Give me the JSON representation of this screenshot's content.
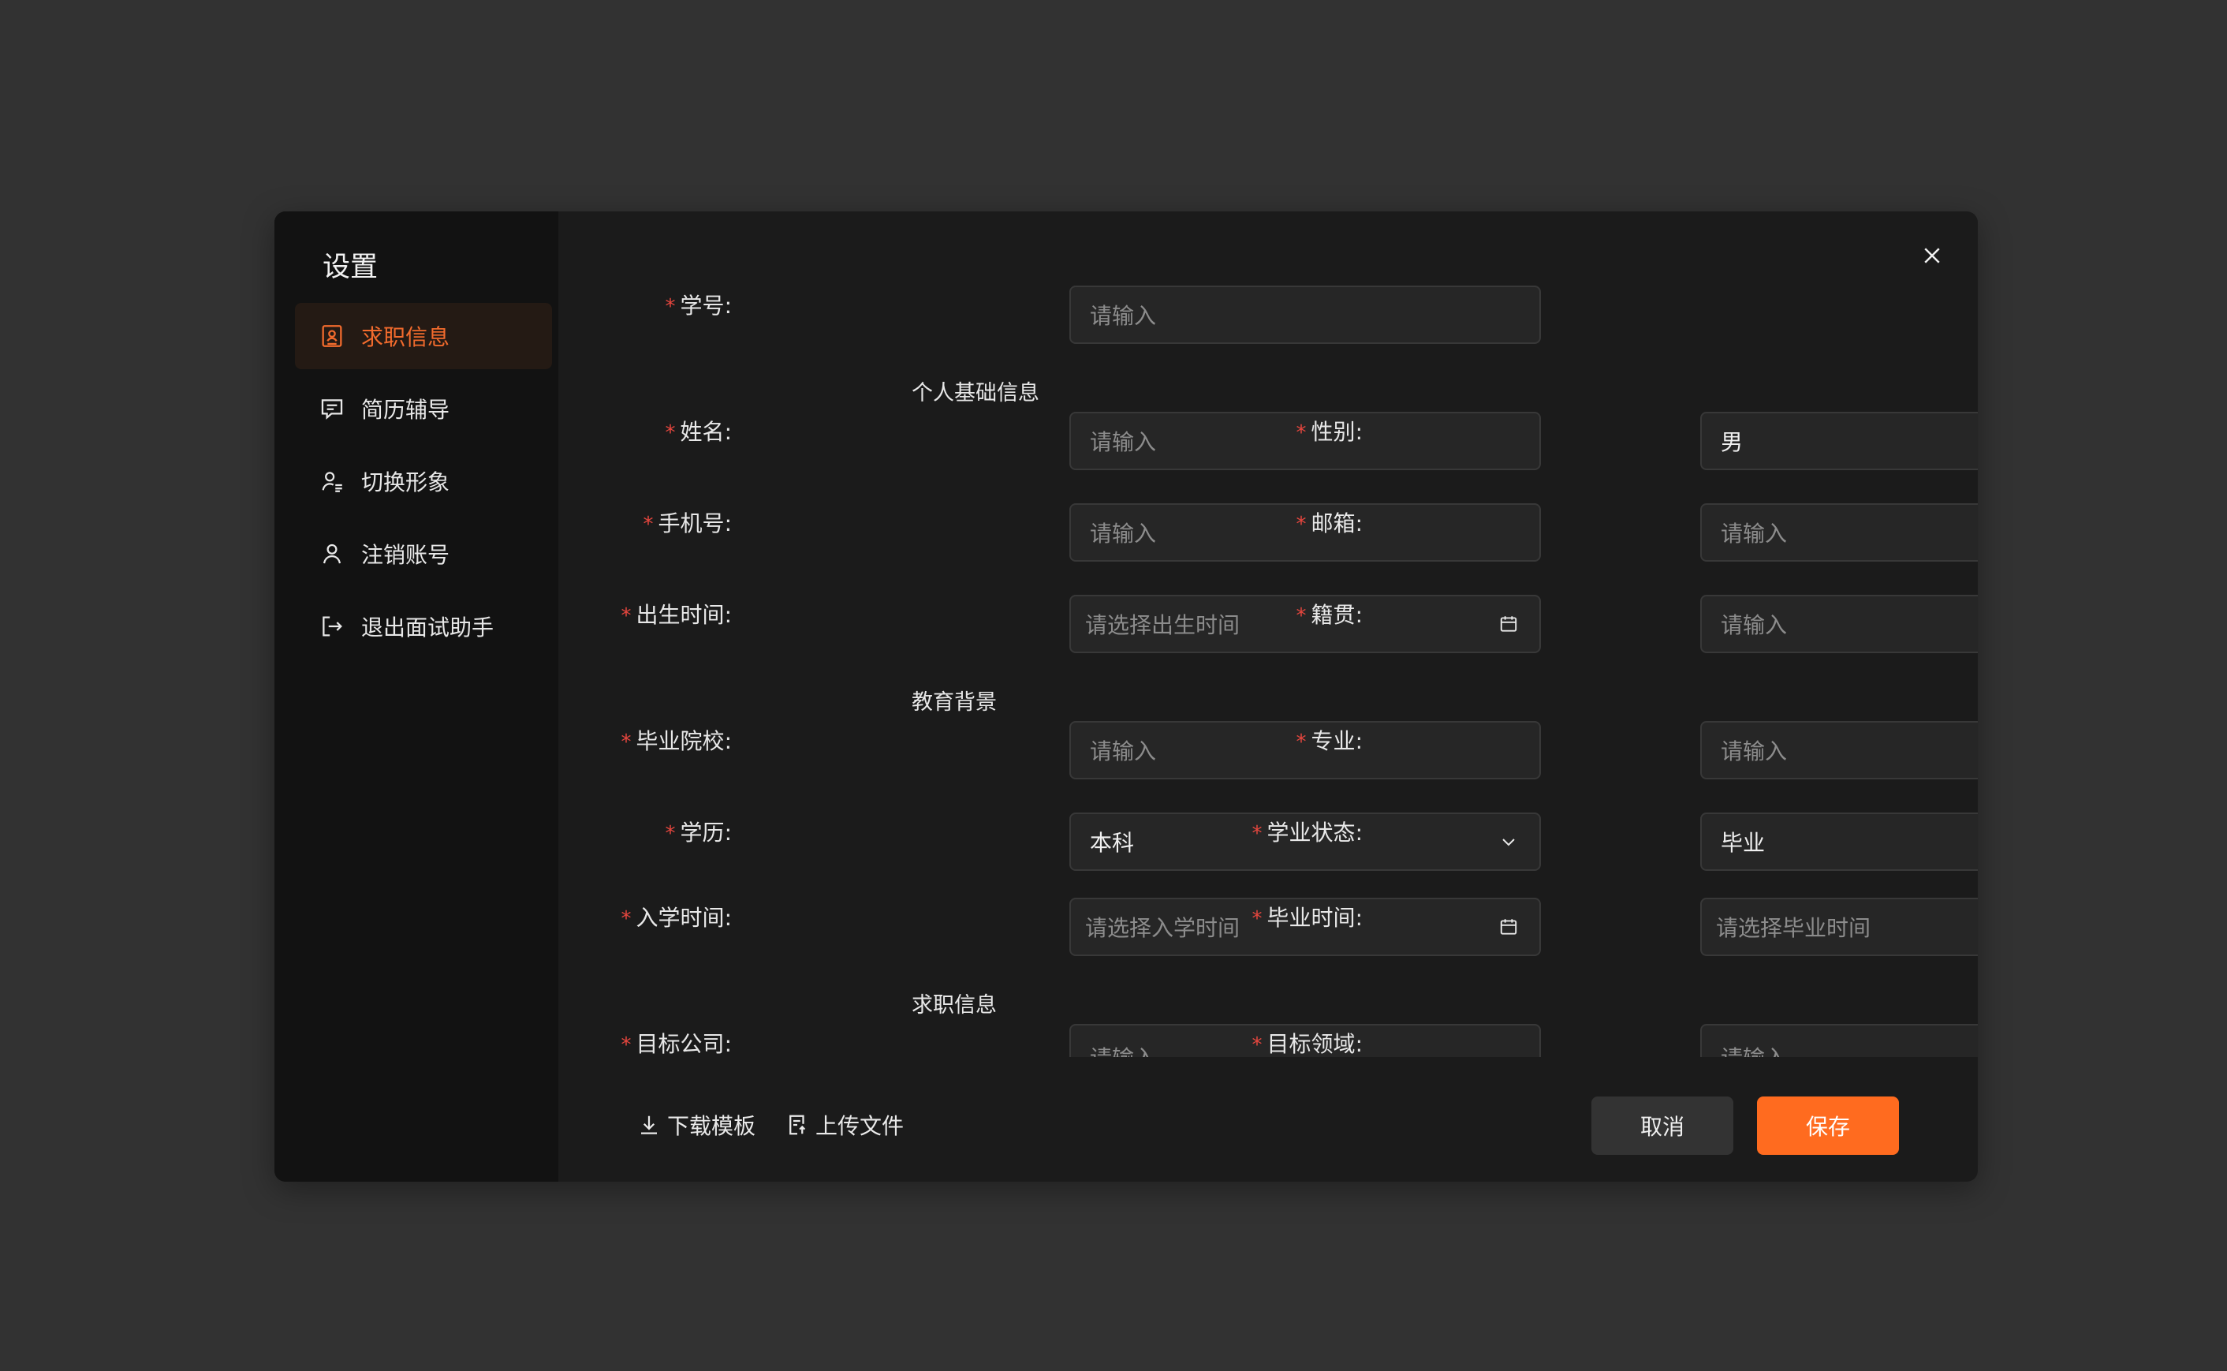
{
  "dialog": {
    "title": "设置"
  },
  "sidebar": {
    "items": [
      {
        "label": "求职信息",
        "icon": "id-card-icon",
        "active": true
      },
      {
        "label": "简历辅导",
        "icon": "message-icon",
        "active": false
      },
      {
        "label": "切换形象",
        "icon": "user-switch-icon",
        "active": false
      },
      {
        "label": "注销账号",
        "icon": "user-icon",
        "active": false
      },
      {
        "label": "退出面试助手",
        "icon": "logout-icon",
        "active": false
      }
    ]
  },
  "form": {
    "student_id": {
      "label": "学号",
      "placeholder": "请输入"
    },
    "section_personal": "个人基础信息",
    "name": {
      "label": "姓名",
      "placeholder": "请输入"
    },
    "gender": {
      "label": "性别",
      "value": "男"
    },
    "phone": {
      "label": "手机号",
      "placeholder": "请输入"
    },
    "email": {
      "label": "邮箱",
      "placeholder": "请输入"
    },
    "birth": {
      "label": "出生时间",
      "placeholder": "请选择出生时间"
    },
    "hometown": {
      "label": "籍贯",
      "placeholder": "请输入"
    },
    "section_education": "教育背景",
    "school": {
      "label": "毕业院校",
      "placeholder": "请输入"
    },
    "major": {
      "label": "专业",
      "placeholder": "请输入"
    },
    "degree": {
      "label": "学历",
      "value": "本科"
    },
    "study_status": {
      "label": "学业状态",
      "value": "毕业"
    },
    "enroll_time": {
      "label": "入学时间",
      "placeholder": "请选择入学时间"
    },
    "grad_time": {
      "label": "毕业时间",
      "placeholder": "请选择毕业时间"
    },
    "section_job": "求职信息",
    "target_company": {
      "label": "目标公司",
      "placeholder": "请输入"
    },
    "target_field": {
      "label": "目标领域",
      "placeholder": "请输入"
    },
    "colon": ":"
  },
  "footer": {
    "download_template": "下载模板",
    "upload_file": "上传文件",
    "cancel": "取消",
    "save": "保存"
  },
  "colors": {
    "accent": "#ff6b1f",
    "required": "#e5463e",
    "active_text": "#f26b2d"
  }
}
